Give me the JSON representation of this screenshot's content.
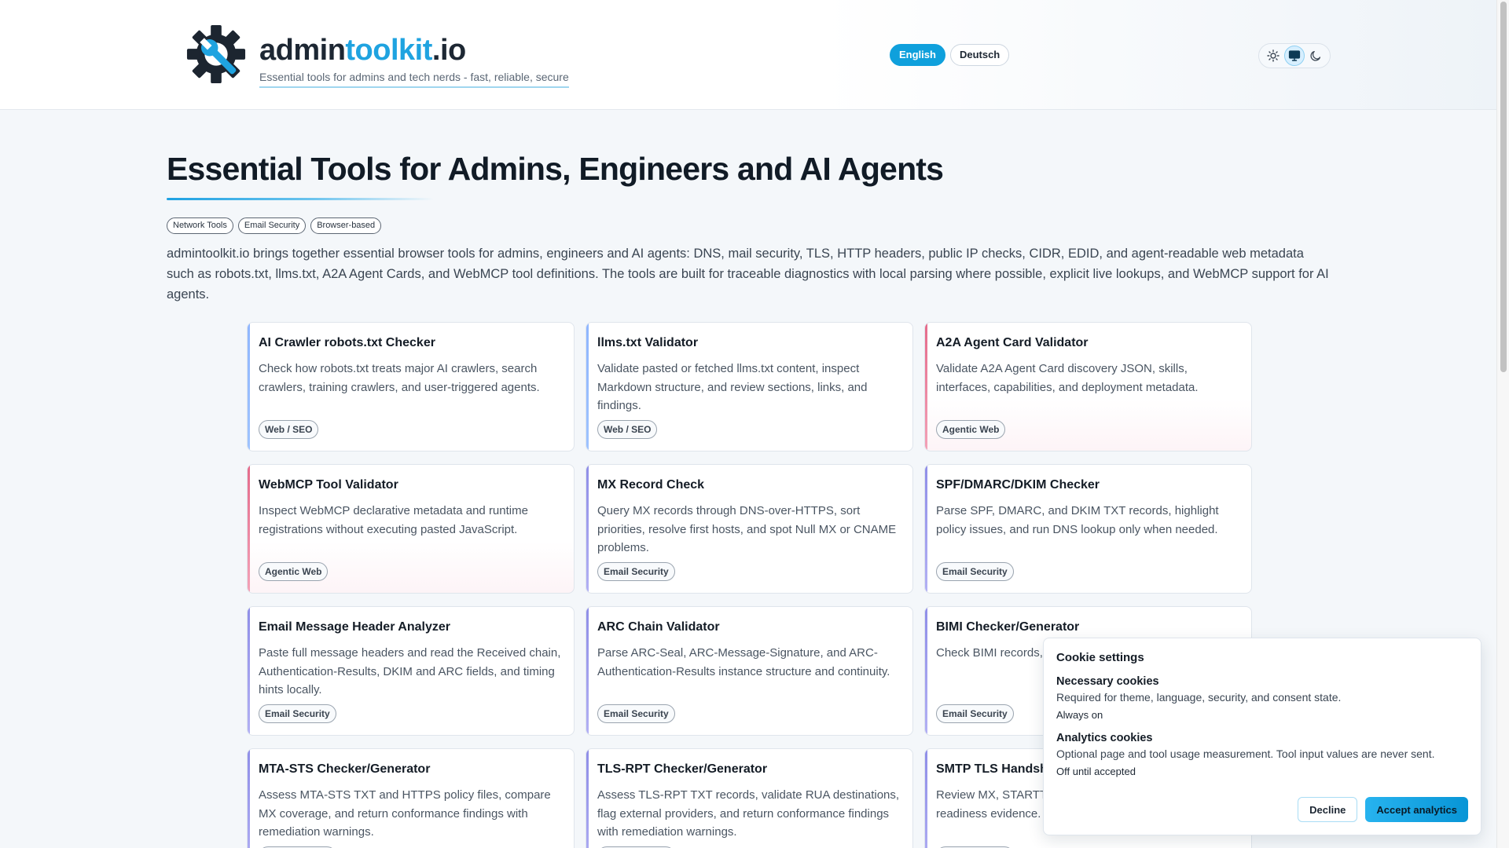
{
  "header": {
    "brand": {
      "part1": "admin",
      "part2": "toolkit",
      "part3": ".io"
    },
    "tagline": "Essential tools for admins and tech nerds - fast, reliable, secure",
    "languages": [
      {
        "label": "English",
        "active": true
      },
      {
        "label": "Deutsch",
        "active": false
      }
    ],
    "theme_options": [
      "sun-icon",
      "monitor-icon",
      "moon-icon"
    ],
    "theme_selected": "monitor-icon"
  },
  "hero": {
    "title": "Essential Tools for Admins, Engineers and AI Agents",
    "tags": [
      "Network Tools",
      "Email Security",
      "Browser-based"
    ],
    "intro": "admintoolkit.io brings together essential browser tools for admins, engineers and AI agents: DNS, mail security, TLS, HTTP headers, public IP checks, CIDR, EDID, and agent-readable web metadata such as robots.txt, llms.txt, A2A Agent Cards, and WebMCP tool definitions. The tools are built for traceable diagnostics with local parsing where possible, explicit live lookups, and WebMCP support for AI agents."
  },
  "cards": [
    {
      "title": "AI Crawler robots.txt Checker",
      "desc": "Check how robots.txt treats major AI crawlers, search crawlers, training crawlers, and user-triggered agents.",
      "badge": "Web / SEO",
      "accent": "blue"
    },
    {
      "title": "llms.txt Validator",
      "desc": "Validate pasted or fetched llms.txt content, inspect Markdown structure, and review sections, links, and findings.",
      "badge": "Web / SEO",
      "accent": "blue"
    },
    {
      "title": "A2A Agent Card Validator",
      "desc": "Validate A2A Agent Card discovery JSON, skills, interfaces, capabilities, and deployment metadata.",
      "badge": "Agentic Web",
      "accent": "pink"
    },
    {
      "title": "WebMCP Tool Validator",
      "desc": "Inspect WebMCP declarative metadata and runtime registrations without executing pasted JavaScript.",
      "badge": "Agentic Web",
      "accent": "pink"
    },
    {
      "title": "MX Record Check",
      "desc": "Query MX records through DNS-over-HTTPS, sort priorities, resolve first hosts, and spot Null MX or CNAME problems.",
      "badge": "Email Security",
      "accent": "violet"
    },
    {
      "title": "SPF/DMARC/DKIM Checker",
      "desc": "Parse SPF, DMARC, and DKIM TXT records, highlight policy issues, and run DNS lookup only when needed.",
      "badge": "Email Security",
      "accent": "violet"
    },
    {
      "title": "Email Message Header Analyzer",
      "desc": "Paste full message headers and read the Received chain, Authentication-Results, DKIM and ARC fields, and timing hints locally.",
      "badge": "Email Security",
      "accent": "violet"
    },
    {
      "title": "ARC Chain Validator",
      "desc": "Parse ARC-Seal, ARC-Message-Signature, and ARC-Authentication-Results instance structure and continuity.",
      "badge": "Email Security",
      "accent": "violet"
    },
    {
      "title": "BIMI Checker/Generator",
      "desc": "Check BIMI records, certificate URLs, and TXT draft.",
      "badge": "Email Security",
      "accent": "violet"
    },
    {
      "title": "MTA-STS Checker/Generator",
      "desc": "Assess MTA-STS TXT and HTTPS policy files, compare MX coverage, and return conformance findings with remediation warnings.",
      "badge": "Email Security",
      "accent": "violet"
    },
    {
      "title": "TLS-RPT Checker/Generator",
      "desc": "Assess TLS-RPT TXT records, validate RUA destinations, flag external providers, and return conformance findings with remediation warnings.",
      "badge": "Email Security",
      "accent": "violet"
    },
    {
      "title": "SMTP TLS Handshake Readiness",
      "desc": "Review MX, STARTTLS, MTA-STS, TLS-RPT, and readiness evidence.",
      "badge": "Email Security",
      "accent": "violet"
    }
  ],
  "cookie": {
    "title": "Cookie settings",
    "necessary_title": "Necessary cookies",
    "necessary_desc": "Required for theme, language, security, and consent state.",
    "necessary_state": "Always on",
    "analytics_title": "Analytics cookies",
    "analytics_desc": "Optional page and tool usage measurement. Tool input values are never sent.",
    "analytics_state": "Off until accepted",
    "decline_label": "Decline",
    "accept_label": "Accept analytics"
  }
}
